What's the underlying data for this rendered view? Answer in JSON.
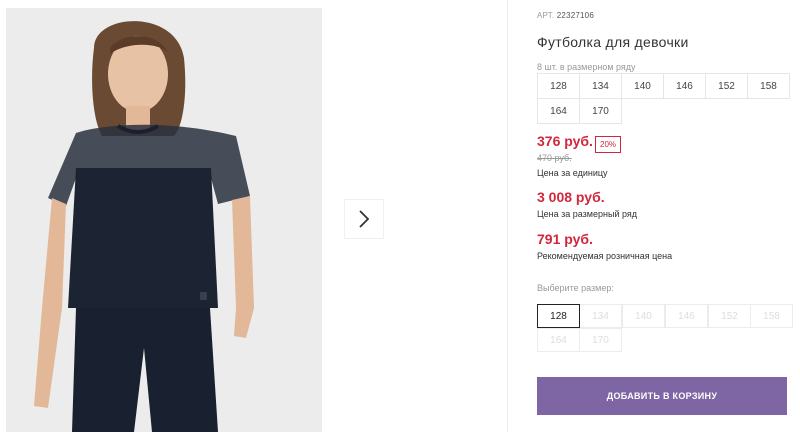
{
  "product": {
    "art_label": "АРТ.",
    "art_number": "22327106",
    "title": "Футболка для девочки"
  },
  "size_row": {
    "note": "8 шт. в размерном ряду",
    "sizes": [
      "128",
      "134",
      "140",
      "146",
      "152",
      "158",
      "164",
      "170"
    ]
  },
  "pricing": {
    "unit_price": "376 руб.",
    "discount": "20%",
    "old_price": "470 руб.",
    "unit_price_label": "Цена за единицу",
    "row_price": "3 008 руб.",
    "row_price_label": "Цена за размерный ряд",
    "retail_price": "791 руб.",
    "retail_price_label": "Рекомендуемая розничная цена"
  },
  "size_picker": {
    "label": "Выберите размер:",
    "selected": "128",
    "options": [
      "128",
      "134",
      "140",
      "146",
      "152",
      "158",
      "164",
      "170"
    ]
  },
  "cart": {
    "button_label": "ДОБАВИТЬ В КОРЗИНУ"
  },
  "colors": {
    "price_red": "#d0273b",
    "cart_purple": "#7d66a3"
  },
  "icons": {
    "next": "chevron-right-icon"
  }
}
